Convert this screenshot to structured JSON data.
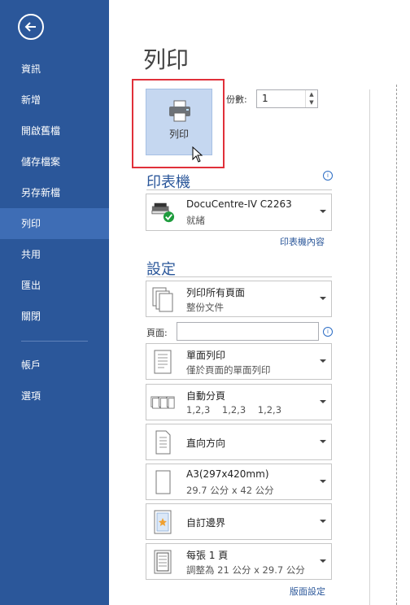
{
  "sidebar": {
    "items": [
      {
        "label": "資訊",
        "active": false
      },
      {
        "label": "新增",
        "active": false
      },
      {
        "label": "開啟舊檔",
        "active": false
      },
      {
        "label": "儲存檔案",
        "active": false
      },
      {
        "label": "另存新檔",
        "active": false
      },
      {
        "label": "列印",
        "active": true
      },
      {
        "label": "共用",
        "active": false
      },
      {
        "label": "匯出",
        "active": false
      },
      {
        "label": "關閉",
        "active": false
      }
    ],
    "bottom_items": [
      {
        "label": "帳戶"
      },
      {
        "label": "選項"
      }
    ]
  },
  "main": {
    "title": "列印",
    "print_button_label": "列印",
    "copies": {
      "label": "份數:",
      "value": "1"
    },
    "printer": {
      "section_title": "印表機",
      "name": "DocuCentre-IV C2263",
      "status": "就緒",
      "properties_link": "印表機內容"
    },
    "settings": {
      "section_title": "設定",
      "print_range": {
        "title": "列印所有頁面",
        "subtitle": "整份文件"
      },
      "pages_label": "頁面:",
      "pages_value": "",
      "sides": {
        "title": "單面列印",
        "subtitle": "僅於頁面的單面列印"
      },
      "collate": {
        "title": "自動分頁",
        "subtitle": "1,2,3    1,2,3    1,2,3"
      },
      "orientation": {
        "title": "直向方向"
      },
      "paper_size": {
        "title": "A3(297x420mm)",
        "subtitle": "29.7 公分 x 42 公分"
      },
      "margins": {
        "title": "自訂邊界"
      },
      "pages_per_sheet": {
        "title": "每張 1 頁",
        "subtitle": "調整為 21 公分 x 29.7 公分"
      },
      "page_setup_link": "版面設定"
    }
  },
  "colors": {
    "sidebar_bg": "#2b579a",
    "sidebar_active": "#3e6db5",
    "accent": "#2b579a",
    "highlight_border": "#e0303a",
    "print_button_bg": "#c5d7f0"
  }
}
